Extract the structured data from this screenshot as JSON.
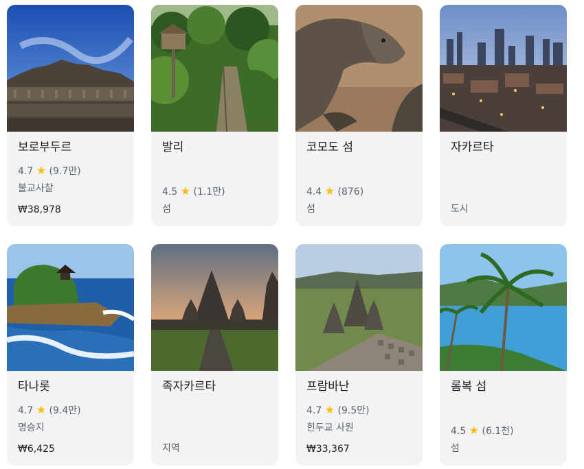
{
  "cards": [
    {
      "title": "보로부두르",
      "rating": "4.7",
      "reviews": "(9.7만)",
      "category": "불교사찰",
      "price": "₩38,978"
    },
    {
      "title": "발리",
      "rating": "4.5",
      "reviews": "(1.1만)",
      "category": "섬"
    },
    {
      "title": "코모도 섬",
      "rating": "4.4",
      "reviews": "(876)",
      "category": "섬"
    },
    {
      "title": "자카르타",
      "category": "도시"
    },
    {
      "title": "타나롯",
      "rating": "4.7",
      "reviews": "(9.4만)",
      "category": "명승지",
      "price": "₩6,425"
    },
    {
      "title": "족자카르타",
      "category": "지역"
    },
    {
      "title": "프람바난",
      "rating": "4.7",
      "reviews": "(9.5만)",
      "category": "힌두교 사원",
      "price": "₩33,367"
    },
    {
      "title": "롬복 섬",
      "rating": "4.5",
      "reviews": "(6.1천)",
      "category": "섬"
    }
  ],
  "icons": {
    "rating": "star-icon"
  },
  "colors": {
    "star": "#fbbc04",
    "card_bg": "#f1f3f4",
    "text_primary": "#202124",
    "text_secondary": "#5f6368"
  }
}
